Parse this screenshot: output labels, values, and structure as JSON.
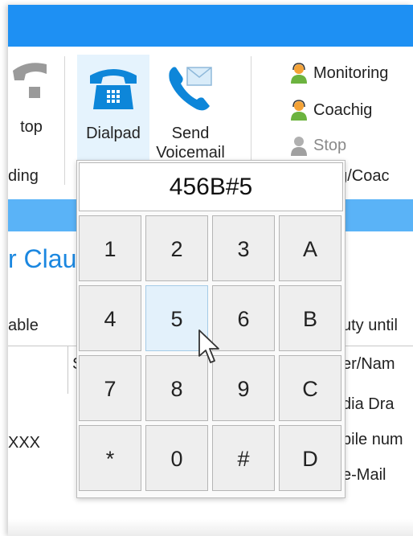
{
  "ribbon": {
    "partial_stop_label": "top",
    "dialpad_label": "Dialpad",
    "send_voicemail_label": "Send\nVoicemail",
    "group_left_label": "ding",
    "monitoring_label": "Monitoring",
    "coaching_label": "Coachig",
    "stop_label": "Stop",
    "group_right_label": "ng/Coac"
  },
  "main": {
    "heading": "r Clau",
    "column_left": "able",
    "column_right": "uty until",
    "row_left_value": "XXX",
    "header_s": "S",
    "right_items": [
      "er/Nam",
      "dia Dra",
      "bile num",
      "e-Mail"
    ]
  },
  "dialpad": {
    "display_value": "456B#5",
    "keys": [
      "1",
      "2",
      "3",
      "A",
      "4",
      "5",
      "6",
      "B",
      "7",
      "8",
      "9",
      "C",
      "*",
      "0",
      "#",
      "D"
    ],
    "hovered_key": "5"
  },
  "colors": {
    "title_blue": "#1e90f3",
    "band_blue": "#5ab3f7",
    "heading_blue": "#1b87e0",
    "phone_blue": "#0d86d9"
  }
}
